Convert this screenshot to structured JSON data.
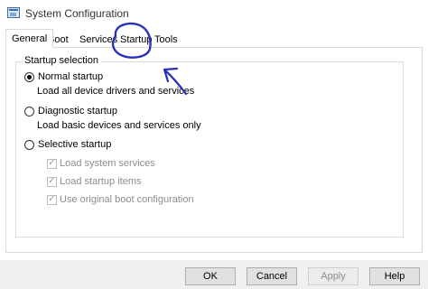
{
  "window": {
    "title": "System Configuration"
  },
  "tabs": [
    {
      "label": "General",
      "active": true
    },
    {
      "label": "Boot",
      "active": false
    },
    {
      "label": "Services",
      "active": false
    },
    {
      "label": "Startup",
      "active": false
    },
    {
      "label": "Tools",
      "active": false
    }
  ],
  "startup_selection": {
    "legend": "Startup selection",
    "normal": {
      "label": "Normal startup",
      "description": "Load all device drivers and services",
      "selected": true
    },
    "diagnostic": {
      "label": "Diagnostic startup",
      "description": "Load basic devices and services only",
      "selected": false
    },
    "selective": {
      "label": "Selective startup",
      "selected": false,
      "options": [
        {
          "label": "Load system services",
          "checked": true,
          "enabled": false
        },
        {
          "label": "Load startup items",
          "checked": true,
          "enabled": false
        },
        {
          "label": "Use original boot configuration",
          "checked": true,
          "enabled": false
        }
      ]
    }
  },
  "buttons": {
    "ok": "OK",
    "cancel": "Cancel",
    "apply": "Apply",
    "help": "Help"
  },
  "colors": {
    "annotation": "#2a2fb8"
  },
  "icons": {
    "app": "system-configuration-icon",
    "checkmark": "✓"
  }
}
